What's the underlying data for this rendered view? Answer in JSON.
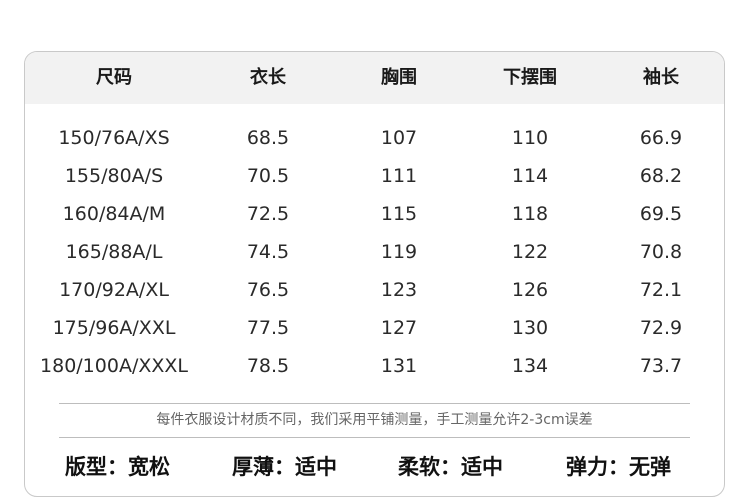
{
  "table": {
    "headers": [
      "尺码",
      "衣长",
      "胸围",
      "下摆围",
      "袖长"
    ],
    "rows": [
      [
        "150/76A/XS",
        "68.5",
        "107",
        "110",
        "66.9"
      ],
      [
        "155/80A/S",
        "70.5",
        "111",
        "114",
        "68.2"
      ],
      [
        "160/84A/M",
        "72.5",
        "115",
        "118",
        "69.5"
      ],
      [
        "165/88A/L",
        "74.5",
        "119",
        "122",
        "70.8"
      ],
      [
        "170/92A/XL",
        "76.5",
        "123",
        "126",
        "72.1"
      ],
      [
        "175/96A/XXL",
        "77.5",
        "127",
        "130",
        "72.9"
      ],
      [
        "180/100A/XXXL",
        "78.5",
        "131",
        "134",
        "73.7"
      ]
    ]
  },
  "note": "每件衣服设计材质不同，我们采用平铺测量，手工测量允许2-3cm误差",
  "properties": [
    {
      "label": "版型：",
      "value": "宽松"
    },
    {
      "label": "厚薄：",
      "value": "适中"
    },
    {
      "label": "柔软：",
      "value": "适中"
    },
    {
      "label": "弹力：",
      "value": "无弹"
    }
  ]
}
